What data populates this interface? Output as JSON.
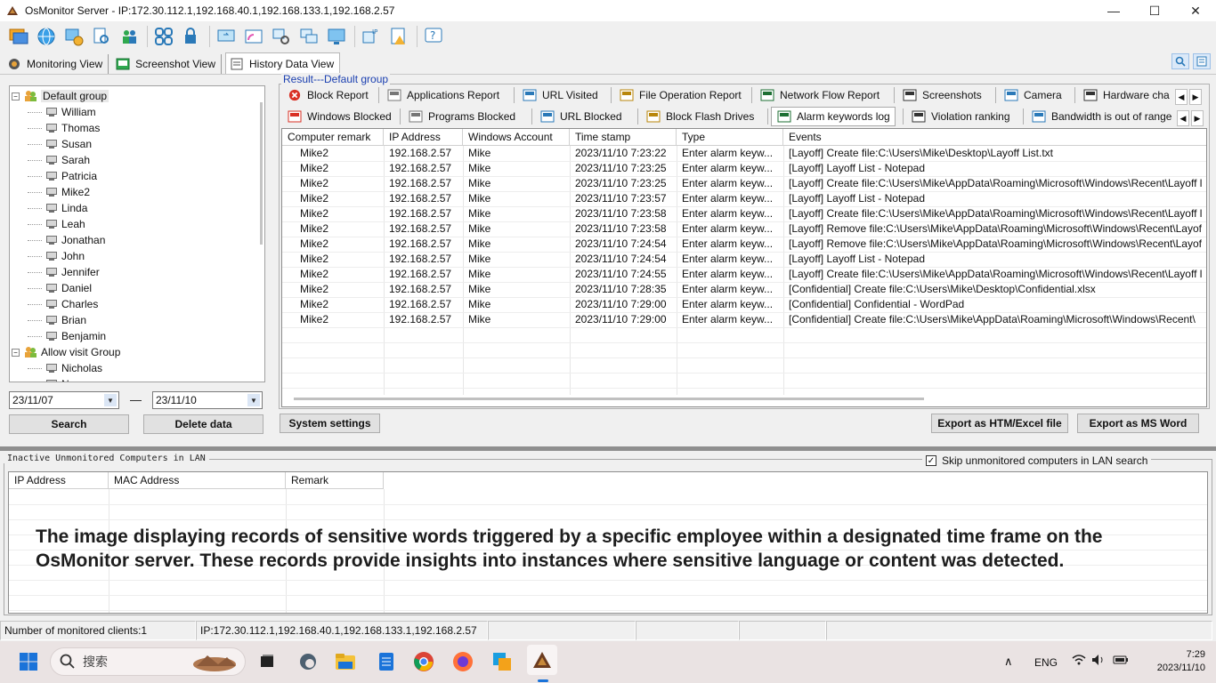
{
  "window": {
    "title": "OsMonitor Server - IP:172.30.112.1,192.168.40.1,192.168.133.1,192.168.2.57",
    "minimize": "—",
    "maximize": "☐",
    "close": "✕"
  },
  "view_tabs": [
    {
      "label": "Monitoring View",
      "icon": "monitor-view-icon"
    },
    {
      "label": "Screenshot View",
      "icon": "screenshot-view-icon"
    },
    {
      "label": "History Data View",
      "icon": "history-data-icon",
      "active": true
    }
  ],
  "tree": {
    "groups": [
      {
        "name": "Default group",
        "members": [
          "William",
          "Thomas",
          "Susan",
          "Sarah",
          "Patricia",
          "Mike2",
          "Linda",
          "Leah",
          "Jonathan",
          "John",
          "Jennifer",
          "Daniel",
          "Charles",
          "Brian",
          "Benjamin"
        ]
      },
      {
        "name": "Allow visit Group",
        "members": [
          "Nicholas",
          "Nancy"
        ]
      }
    ]
  },
  "dates": {
    "from": "23/11/07",
    "dash": "—",
    "to": "23/11/10"
  },
  "left_buttons": {
    "search": "Search",
    "delete": "Delete data"
  },
  "result": {
    "legend": "Result---Default group",
    "tabs_row1": [
      "Block Report",
      "Applications Report",
      "URL Visited",
      "File Operation Report",
      "Network Flow Report",
      "Screenshots",
      "Camera",
      "Hardware cha"
    ],
    "tabs_row2": [
      "Windows Blocked",
      "Programs Blocked",
      "URL Blocked",
      "Block Flash Drives",
      "Alarm keywords log",
      "Violation ranking",
      "Bandwidth is out of range"
    ],
    "active_tab": "Alarm keywords log",
    "columns": [
      "Computer remark",
      "IP Address",
      "Windows Account",
      "Time stamp",
      "Type",
      "Events"
    ],
    "rows": [
      [
        "Mike2",
        "192.168.2.57",
        "Mike",
        "2023/11/10 7:23:22",
        "Enter alarm keyw...",
        "[Layoff] Create file:C:\\Users\\Mike\\Desktop\\Layoff List.txt"
      ],
      [
        "Mike2",
        "192.168.2.57",
        "Mike",
        "2023/11/10 7:23:25",
        "Enter alarm keyw...",
        "[Layoff] Layoff List - Notepad"
      ],
      [
        "Mike2",
        "192.168.2.57",
        "Mike",
        "2023/11/10 7:23:25",
        "Enter alarm keyw...",
        "[Layoff] Create file:C:\\Users\\Mike\\AppData\\Roaming\\Microsoft\\Windows\\Recent\\Layoff l"
      ],
      [
        "Mike2",
        "192.168.2.57",
        "Mike",
        "2023/11/10 7:23:57",
        "Enter alarm keyw...",
        "[Layoff] Layoff List - Notepad"
      ],
      [
        "Mike2",
        "192.168.2.57",
        "Mike",
        "2023/11/10 7:23:58",
        "Enter alarm keyw...",
        "[Layoff] Create file:C:\\Users\\Mike\\AppData\\Roaming\\Microsoft\\Windows\\Recent\\Layoff l"
      ],
      [
        "Mike2",
        "192.168.2.57",
        "Mike",
        "2023/11/10 7:23:58",
        "Enter alarm keyw...",
        "[Layoff] Remove file:C:\\Users\\Mike\\AppData\\Roaming\\Microsoft\\Windows\\Recent\\Layof"
      ],
      [
        "Mike2",
        "192.168.2.57",
        "Mike",
        "2023/11/10 7:24:54",
        "Enter alarm keyw...",
        "[Layoff] Remove file:C:\\Users\\Mike\\AppData\\Roaming\\Microsoft\\Windows\\Recent\\Layof"
      ],
      [
        "Mike2",
        "192.168.2.57",
        "Mike",
        "2023/11/10 7:24:54",
        "Enter alarm keyw...",
        "[Layoff] Layoff List - Notepad"
      ],
      [
        "Mike2",
        "192.168.2.57",
        "Mike",
        "2023/11/10 7:24:55",
        "Enter alarm keyw...",
        "[Layoff] Create file:C:\\Users\\Mike\\AppData\\Roaming\\Microsoft\\Windows\\Recent\\Layoff l"
      ],
      [
        "Mike2",
        "192.168.2.57",
        "Mike",
        "2023/11/10 7:28:35",
        "Enter alarm keyw...",
        "[Confidential] Create file:C:\\Users\\Mike\\Desktop\\Confidential.xlsx"
      ],
      [
        "Mike2",
        "192.168.2.57",
        "Mike",
        "2023/11/10 7:29:00",
        "Enter alarm keyw...",
        "[Confidential] Confidential - WordPad"
      ],
      [
        "Mike2",
        "192.168.2.57",
        "Mike",
        "2023/11/10 7:29:00",
        "Enter alarm keyw...",
        "[Confidential] Create file:C:\\Users\\Mike\\AppData\\Roaming\\Microsoft\\Windows\\Recent\\"
      ]
    ]
  },
  "bottom_buttons": {
    "settings": "System settings",
    "export_htm": "Export as HTM/Excel file",
    "export_word": "Export as MS Word"
  },
  "inactive": {
    "title": "Inactive Unmonitored Computers in LAN",
    "skip_label": "Skip unmonitored computers in LAN search",
    "skip_checked": true,
    "columns": [
      "IP Address",
      "MAC Address",
      "Remark"
    ],
    "caption": "The image displaying records of sensitive words triggered by a specific employee within a designated time frame on the OsMonitor server. These records provide insights into instances where sensitive language or content was detected."
  },
  "status": {
    "clients": "Number of monitored clients:1",
    "ips": "IP:172.30.112.1,192.168.40.1,192.168.133.1,192.168.2.57"
  },
  "taskbar": {
    "search_placeholder": "搜索",
    "lang": "ENG",
    "time": "7:29",
    "date": "2023/11/10"
  },
  "colors": {
    "accent_blue": "#1a3fb0",
    "block_red": "#d93025"
  }
}
